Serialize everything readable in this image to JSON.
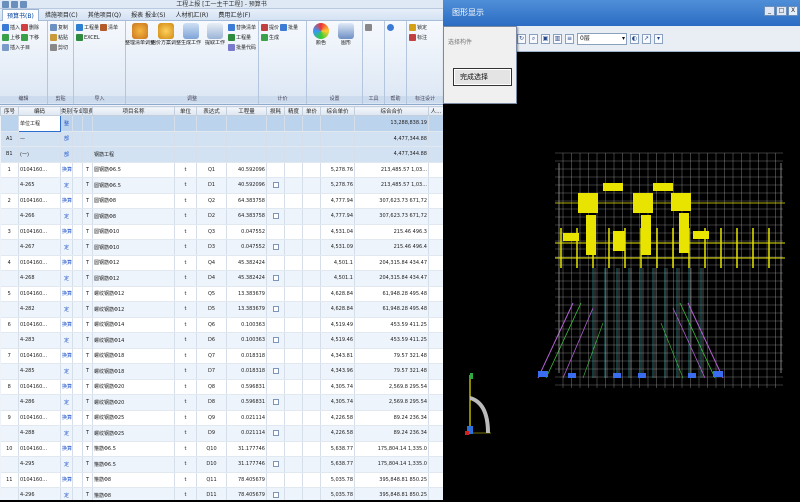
{
  "window": {
    "title": "工程上报 [工一主干工程] - 预算书"
  },
  "menu_tabs": [
    {
      "label": "预算书(B)",
      "active": true
    },
    {
      "label": "措施项目(C)",
      "active": false
    },
    {
      "label": "其他项目(Q)",
      "active": false
    },
    {
      "label": "报表 报业(S)",
      "active": false
    },
    {
      "label": "人材机汇(R)",
      "active": false
    },
    {
      "label": "费用汇总(F)",
      "active": false
    }
  ],
  "ribbon": {
    "group1": {
      "items": [
        "插入",
        "删除",
        "上移",
        "下移",
        "插入子目",
        "下移"
      ],
      "label": "编辑"
    },
    "group2": {
      "items": [
        "复制",
        "粘贴",
        "导入",
        "剪切"
      ],
      "label": "剪贴"
    },
    "group3": {
      "items": [
        "工程量",
        "清单",
        "EXCEL"
      ],
      "label": "导入"
    },
    "group4": {
      "items": [
        "整理清单调整",
        "组价方案调整",
        "生成工作",
        "提取工作",
        "清单指引",
        "自动套价",
        "工程量",
        "批量代码",
        "替换清单",
        "工程量明细",
        "清单项目特征"
      ],
      "label": "调整"
    },
    "group5": {
      "items": [
        "提价",
        "批量",
        "生成"
      ],
      "label": "计价"
    },
    "group6": {
      "items": [
        "颜色",
        "图形",
        "显示"
      ],
      "label": "设置"
    },
    "group7": {
      "items": [
        "查看",
        "工具"
      ],
      "label": "工具"
    },
    "group8": {
      "items": [
        "帮助",
        "标注"
      ],
      "label": "帮助"
    },
    "group9": {
      "items": [
        "锁定",
        "标注",
        "数据"
      ],
      "label": "标注设计"
    }
  },
  "table": {
    "columns": [
      "序号",
      "编码",
      "类别",
      "专业",
      "取费",
      "项目名称",
      "单位",
      "表达式",
      "工程量",
      "损耗",
      "精度",
      "单价",
      "综合单价",
      "综合合价",
      "人..."
    ],
    "rows": [
      {
        "type": "sel",
        "seq": "",
        "code": "单位工程",
        "cat": "整",
        "name": "",
        "unit": "",
        "expr": "",
        "qty": "",
        "chk": false,
        "price": "",
        "total": "13,288,838.19"
      },
      {
        "type": "grp",
        "seq": "A1",
        "code": "—",
        "cat": "部",
        "name": "",
        "unit": "",
        "expr": "",
        "qty": "",
        "chk": false,
        "price": "",
        "total": "4,477,344.88"
      },
      {
        "type": "grp",
        "seq": "B1",
        "code": "(一)",
        "cat": "部",
        "name": "钢筋工程",
        "unit": "",
        "expr": "",
        "qty": "",
        "chk": false,
        "price": "",
        "total": "4,477,344.88"
      },
      {
        "type": "odd",
        "seq": "1",
        "code": "0104160...",
        "cat": "换算",
        "spec": "T",
        "name": "圆钢筋Φ6.5",
        "unit": "t",
        "expr": "Q1",
        "qty": "40.592096",
        "chk": false,
        "price": "5,278.76",
        "total": "213,485.57 1,03..."
      },
      {
        "type": "even",
        "seq": "",
        "code": "4-265",
        "cat": "定",
        "spec": "T",
        "name": "圆钢筋Φ6.5",
        "unit": "t",
        "expr": "D1",
        "qty": "40.592096",
        "chk": true,
        "price": "5,278.76",
        "total": "213,485.57 1,03..."
      },
      {
        "type": "odd",
        "seq": "2",
        "code": "0104160...",
        "cat": "换算",
        "spec": "T",
        "name": "圆钢筋Φ8",
        "unit": "t",
        "expr": "Q2",
        "qty": "64.383758",
        "chk": false,
        "price": "4,777.94",
        "total": "307,623.73 671,72"
      },
      {
        "type": "even",
        "seq": "",
        "code": "4-266",
        "cat": "定",
        "spec": "T",
        "name": "圆钢筋Φ8",
        "unit": "t",
        "expr": "D2",
        "qty": "64.383758",
        "chk": true,
        "price": "4,777.94",
        "total": "307,623.73 671,72"
      },
      {
        "type": "odd",
        "seq": "3",
        "code": "0104160...",
        "cat": "换算",
        "spec": "T",
        "name": "圆钢筋Φ10",
        "unit": "t",
        "expr": "Q3",
        "qty": "0.047552",
        "chk": false,
        "price": "4,531.04",
        "total": "215.46 496.3"
      },
      {
        "type": "even",
        "seq": "",
        "code": "4-267",
        "cat": "定",
        "spec": "T",
        "name": "圆钢筋Φ10",
        "unit": "t",
        "expr": "D3",
        "qty": "0.047552",
        "chk": true,
        "price": "4,531.09",
        "total": "215.46 496.4"
      },
      {
        "type": "odd",
        "seq": "4",
        "code": "0104160...",
        "cat": "换算",
        "spec": "T",
        "name": "圆钢筋Φ12",
        "unit": "t",
        "expr": "Q4",
        "qty": "45.382424",
        "chk": false,
        "price": "4,501.1",
        "total": "204,315.84 434.47"
      },
      {
        "type": "even",
        "seq": "",
        "code": "4-268",
        "cat": "定",
        "spec": "T",
        "name": "圆钢筋Φ12",
        "unit": "t",
        "expr": "D4",
        "qty": "45.382424",
        "chk": true,
        "price": "4,501.1",
        "total": "204,315.84 434.47"
      },
      {
        "type": "odd",
        "seq": "5",
        "code": "0104160...",
        "cat": "换算",
        "spec": "T",
        "name": "螺纹钢筋Φ12",
        "unit": "t",
        "expr": "Q5",
        "qty": "13.383679",
        "chk": false,
        "price": "4,628.84",
        "total": "61,948.28 495.48"
      },
      {
        "type": "even",
        "seq": "",
        "code": "4-282",
        "cat": "定",
        "spec": "T",
        "name": "螺纹钢筋Φ12",
        "unit": "t",
        "expr": "D5",
        "qty": "13.383679",
        "chk": true,
        "price": "4,628.84",
        "total": "61,948.28 495.48"
      },
      {
        "type": "odd",
        "seq": "6",
        "code": "0104160...",
        "cat": "换算",
        "spec": "T",
        "name": "螺纹钢筋Φ14",
        "unit": "t",
        "expr": "Q6",
        "qty": "0.100363",
        "chk": false,
        "price": "4,519.49",
        "total": "453.59 411.25"
      },
      {
        "type": "even",
        "seq": "",
        "code": "4-283",
        "cat": "定",
        "spec": "T",
        "name": "螺纹钢筋Φ14",
        "unit": "t",
        "expr": "D6",
        "qty": "0.100363",
        "chk": true,
        "price": "4,519.46",
        "total": "453.59 411.25"
      },
      {
        "type": "odd",
        "seq": "7",
        "code": "0104160...",
        "cat": "换算",
        "spec": "T",
        "name": "螺纹钢筋Φ18",
        "unit": "t",
        "expr": "Q7",
        "qty": "0.018318",
        "chk": false,
        "price": "4,343.81",
        "total": "79.57 321.48"
      },
      {
        "type": "even",
        "seq": "",
        "code": "4-285",
        "cat": "定",
        "spec": "T",
        "name": "螺纹钢筋Φ18",
        "unit": "t",
        "expr": "D7",
        "qty": "0.018318",
        "chk": true,
        "price": "4,343.96",
        "total": "79.57 321.48"
      },
      {
        "type": "odd",
        "seq": "8",
        "code": "0104160...",
        "cat": "换算",
        "spec": "T",
        "name": "螺纹钢筋Φ20",
        "unit": "t",
        "expr": "Q8",
        "qty": "0.596831",
        "chk": false,
        "price": "4,305.74",
        "total": "2,569.8 295.54"
      },
      {
        "type": "even",
        "seq": "",
        "code": "4-286",
        "cat": "定",
        "spec": "T",
        "name": "螺纹钢筋Φ20",
        "unit": "t",
        "expr": "D8",
        "qty": "0.596831",
        "chk": true,
        "price": "4,305.74",
        "total": "2,569.8 295.54"
      },
      {
        "type": "odd",
        "seq": "9",
        "code": "0104160...",
        "cat": "换算",
        "spec": "T",
        "name": "螺纹钢筋Φ25",
        "unit": "t",
        "expr": "Q9",
        "qty": "0.021114",
        "chk": false,
        "price": "4,226.58",
        "total": "89.24 236.34"
      },
      {
        "type": "even",
        "seq": "",
        "code": "4-288",
        "cat": "定",
        "spec": "T",
        "name": "螺纹钢筋Φ25",
        "unit": "t",
        "expr": "D9",
        "qty": "0.021114",
        "chk": true,
        "price": "4,226.58",
        "total": "89.24 236.34"
      },
      {
        "type": "odd",
        "seq": "10",
        "code": "0104160...",
        "cat": "换算",
        "spec": "T",
        "name": "箍筋Φ6.5",
        "unit": "t",
        "expr": "Q10",
        "qty": "31.177746",
        "chk": false,
        "price": "5,638.77",
        "total": "175,804.14 1,335.0"
      },
      {
        "type": "even",
        "seq": "",
        "code": "4-295",
        "cat": "定",
        "spec": "T",
        "name": "箍筋Φ6.5",
        "unit": "t",
        "expr": "D10",
        "qty": "31.177746",
        "chk": true,
        "price": "5,638.77",
        "total": "175,804.14 1,335.0"
      },
      {
        "type": "odd",
        "seq": "11",
        "code": "0104160...",
        "cat": "换算",
        "spec": "T",
        "name": "箍筋Φ8",
        "unit": "t",
        "expr": "Q11",
        "qty": "78.405679",
        "chk": false,
        "price": "5,035.78",
        "total": "395,848.81 850.25"
      },
      {
        "type": "even",
        "seq": "",
        "code": "4-296",
        "cat": "定",
        "spec": "T",
        "name": "箍筋Φ8",
        "unit": "t",
        "expr": "D11",
        "qty": "78.405679",
        "chk": true,
        "price": "5,035.78",
        "total": "395,848.81 850.25"
      }
    ]
  },
  "right_window": {
    "title": "图形显示",
    "layer_combo": "0层",
    "buttons": {
      "min": "_",
      "max": "□",
      "close": "X"
    }
  },
  "popup": {
    "label": "选择构件",
    "done_button": "完成选择"
  }
}
